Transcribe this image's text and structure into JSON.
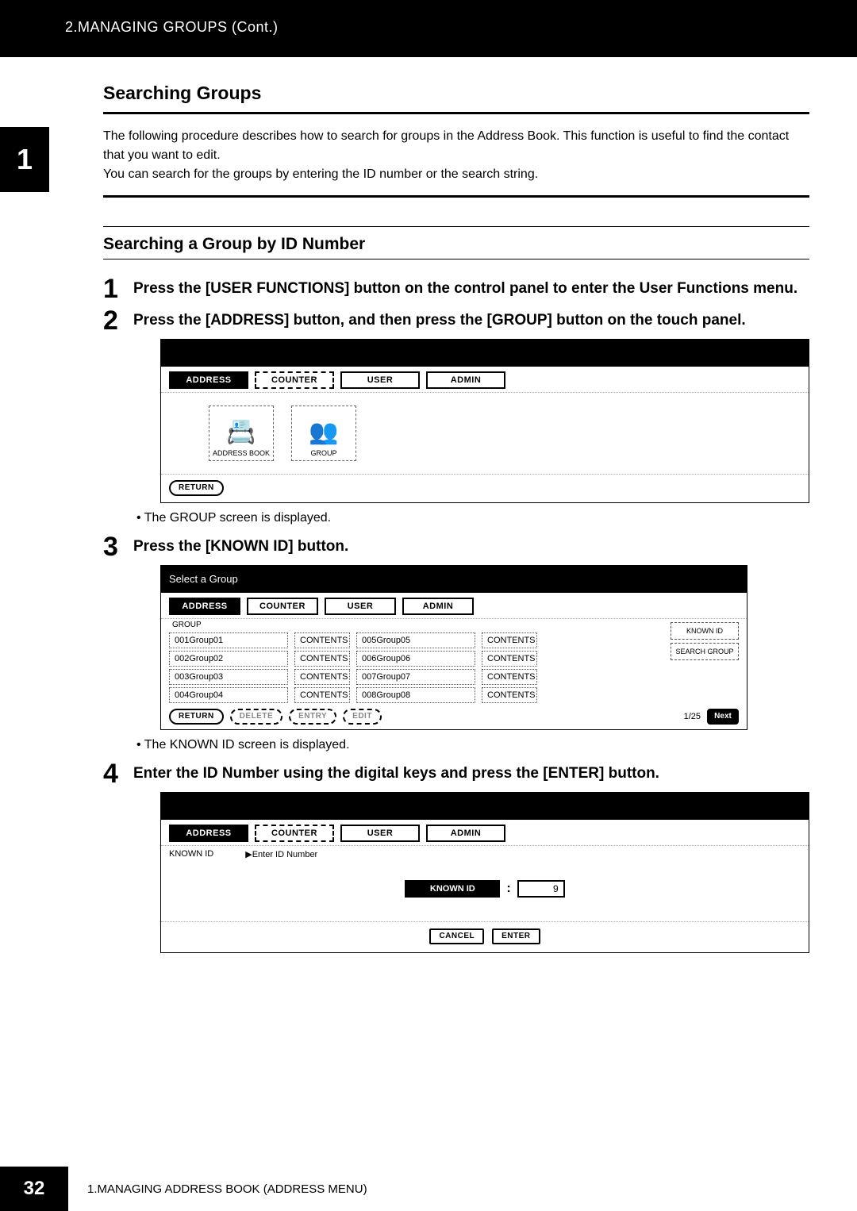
{
  "header": {
    "breadcrumb": "2.MANAGING GROUPS (Cont.)"
  },
  "side_tab": "1",
  "section": {
    "title": "Searching Groups",
    "intro_line1": "The following procedure describes how to search for groups in the Address Book.  This function is useful to find the contact that you want to edit.",
    "intro_line2": "You can search for the groups by entering the ID number or the search string."
  },
  "subsection": {
    "title": "Searching a Group by ID Number"
  },
  "steps": [
    {
      "num": "1",
      "text": "Press the [USER FUNCTIONS] button on the control panel to enter the User Functions menu."
    },
    {
      "num": "2",
      "text": "Press the [ADDRESS] button, and then press the [GROUP] button on the touch panel."
    },
    {
      "num": "3",
      "text": "Press the [KNOWN ID] button."
    },
    {
      "num": "4",
      "text": "Enter the ID Number using the digital keys and press the [ENTER] button."
    }
  ],
  "notes": {
    "after2": "The GROUP screen is displayed.",
    "after3": "The KNOWN ID screen is displayed."
  },
  "panelA": {
    "tabs": {
      "address": "ADDRESS",
      "counter": "COUNTER",
      "user": "USER",
      "admin": "ADMIN"
    },
    "icons": {
      "addressbook": "ADDRESS BOOK",
      "group": "GROUP"
    },
    "return": "RETURN"
  },
  "panelB": {
    "title": "Select a Group",
    "tabs": {
      "address": "ADDRESS",
      "counter": "COUNTER",
      "user": "USER",
      "admin": "ADMIN"
    },
    "group_label": "GROUP",
    "rows_left": [
      {
        "id": "001",
        "name": "Group01"
      },
      {
        "id": "002",
        "name": "Group02"
      },
      {
        "id": "003",
        "name": "Group03"
      },
      {
        "id": "004",
        "name": "Group04"
      }
    ],
    "rows_right": [
      {
        "id": "005",
        "name": "Group05"
      },
      {
        "id": "006",
        "name": "Group06"
      },
      {
        "id": "007",
        "name": "Group07"
      },
      {
        "id": "008",
        "name": "Group08"
      }
    ],
    "contents": "CONTENTS",
    "side": {
      "known_id": "KNOWN ID",
      "search_group": "SEARCH GROUP"
    },
    "bottom": {
      "return": "RETURN",
      "delete": "DELETE",
      "entry": "ENTRY",
      "edit": "EDIT",
      "page": "1/25",
      "next": "Next"
    }
  },
  "panelC": {
    "tabs": {
      "address": "ADDRESS",
      "counter": "COUNTER",
      "user": "USER",
      "admin": "ADMIN"
    },
    "row": {
      "label": "KNOWN ID",
      "prompt": "▶Enter ID Number"
    },
    "known_id_label": "KNOWN ID",
    "value": "9",
    "cancel": "CANCEL",
    "enter": "ENTER"
  },
  "footer": {
    "page": "32",
    "text": "1.MANAGING ADDRESS BOOK (ADDRESS MENU)"
  }
}
